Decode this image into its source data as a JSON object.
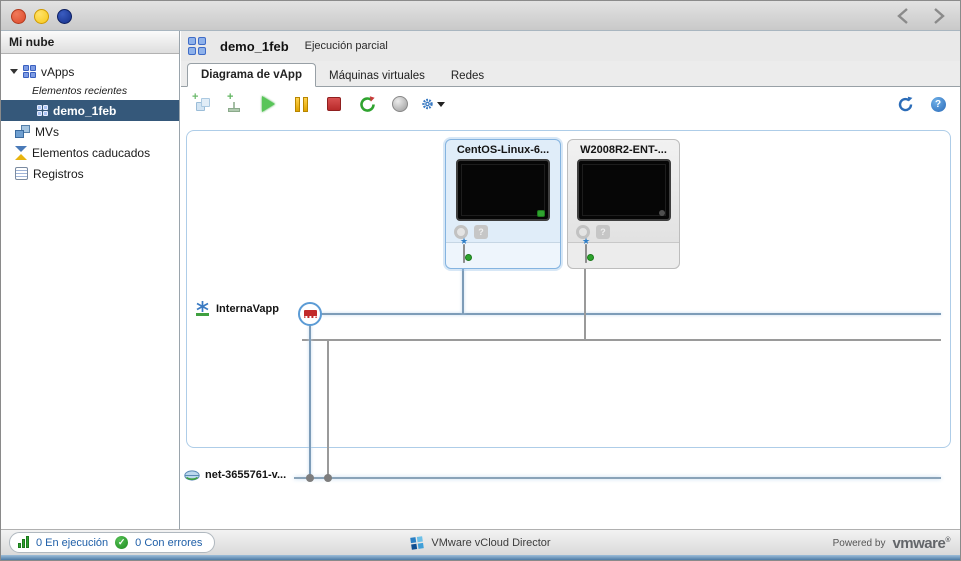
{
  "titlebar": {
    "window_buttons": [
      "close",
      "minimize",
      "zoom"
    ],
    "nav": [
      "back",
      "forward"
    ]
  },
  "sidebar": {
    "title": "Mi nube",
    "tree": {
      "vapps_label": "vApps",
      "recents_label": "Elementos recientes",
      "selected_item": "demo_1feb",
      "mvs_label": "MVs",
      "expired_label": "Elementos caducados",
      "logs_label": "Registros"
    }
  },
  "header": {
    "title": "demo_1feb",
    "status": "Ejecución parcial"
  },
  "tabs": {
    "diagram": "Diagrama de vApp",
    "vms": "Máquinas virtuales",
    "networks": "Redes"
  },
  "toolbar": {
    "buttons": [
      "add-vm",
      "add-network",
      "start",
      "suspend",
      "stop",
      "reset",
      "console",
      "actions"
    ],
    "right_buttons": [
      "refresh",
      "help"
    ],
    "help_glyph": "?"
  },
  "diagram": {
    "vms": [
      {
        "name": "CentOS-Linux-6...",
        "selected": true,
        "indicator": "tools-running"
      },
      {
        "name": "W2008R2-ENT-...",
        "selected": false,
        "indicator": "powered-off"
      }
    ],
    "networks": [
      {
        "name": "InternaVapp"
      },
      {
        "name": "net-3655761-v..."
      }
    ]
  },
  "statusbar": {
    "running": "0 En ejecución",
    "errors": "0 Con errores",
    "product": "VMware vCloud Director",
    "powered_by": "Powered by",
    "brand": "vmware",
    "reg_mark": "®"
  },
  "colors": {
    "selection_blue": "#35587a",
    "accent_blue": "#2b6cb8",
    "canvas_border": "#aecde8",
    "line_blue": "#7d9cb8",
    "line_gray": "#9a9a9a",
    "status_link": "#1f5fa8",
    "start_green": "#58c558",
    "stop_red": "#b82a2a",
    "pause_amber": "#e0a400"
  }
}
